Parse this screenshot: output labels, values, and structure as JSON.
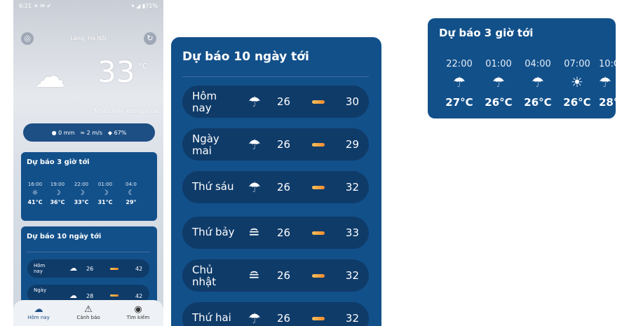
{
  "phone": {
    "status_left": "6:21 ☀ ✉ ✔",
    "status_right": "▾ ◢ ▮71%",
    "location": "Láng, Hà Nội",
    "temperature": "33",
    "unit": "°C",
    "condition": "Nhiều mây không mưa",
    "stats": {
      "rain": "0 mm",
      "wind": "2 m/s",
      "humidity": "67%"
    },
    "hourly_title": "Dự báo 3 giờ tới",
    "hourly": [
      {
        "time": "16:00",
        "icon": "☼",
        "temp": "41°C"
      },
      {
        "time": "19:00",
        "icon": "☽",
        "temp": "36°C"
      },
      {
        "time": "22:00",
        "icon": "☽",
        "temp": "33°C"
      },
      {
        "time": "01:00",
        "icon": "☽",
        "temp": "31°C"
      },
      {
        "time": "04:0",
        "icon": "☾",
        "temp": "29°"
      }
    ],
    "daily_title": "Dự báo 10 ngày tới",
    "daily": [
      {
        "day": "Hôm nay",
        "icon": "☁",
        "lo": "26",
        "hi": "42"
      },
      {
        "day": "Ngày",
        "icon": "☁",
        "lo": "28",
        "hi": "42"
      }
    ],
    "nav": [
      {
        "label": "Hôm nay",
        "icon": "☁"
      },
      {
        "label": "Cảnh báo",
        "icon": "⚠"
      },
      {
        "label": "Tìm kiếm",
        "icon": "◉"
      }
    ]
  },
  "forecast10": {
    "title": "Dự báo 10 ngày tới",
    "rows": [
      {
        "day_line1": "Hôm",
        "day_line2": "nay",
        "icon": "☂",
        "lo": "26",
        "hi": "30"
      },
      {
        "day_line1": "Ngày",
        "day_line2": "mai",
        "icon": "☂",
        "lo": "26",
        "hi": "29"
      },
      {
        "day_line1": "Thứ sáu",
        "day_line2": "",
        "icon": "☂",
        "lo": "26",
        "hi": "32"
      },
      {
        "day_line1": "Thứ bảy",
        "day_line2": "",
        "icon": "≘",
        "lo": "26",
        "hi": "33"
      },
      {
        "day_line1": "Chủ",
        "day_line2": "nhật",
        "icon": "≘",
        "lo": "26",
        "hi": "32"
      },
      {
        "day_line1": "Thứ hai",
        "day_line2": "",
        "icon": "☂",
        "lo": "26",
        "hi": "32"
      }
    ]
  },
  "forecast3h": {
    "title": "Dự báo 3 giờ tới",
    "cells": [
      {
        "time": "22:00",
        "icon": "☂",
        "temp": "27°C"
      },
      {
        "time": "01:00",
        "icon": "☂",
        "temp": "26°C"
      },
      {
        "time": "04:00",
        "icon": "☂",
        "temp": "26°C"
      },
      {
        "time": "07:00",
        "icon": "☀",
        "temp": "26°C"
      },
      {
        "time": "10:C",
        "icon": "☂",
        "temp": "28°"
      }
    ]
  },
  "colors": {
    "card": "#12508a",
    "row": "#0f3b69",
    "bar_start": "#f6c15a",
    "bar_end": "#f28a2e"
  }
}
